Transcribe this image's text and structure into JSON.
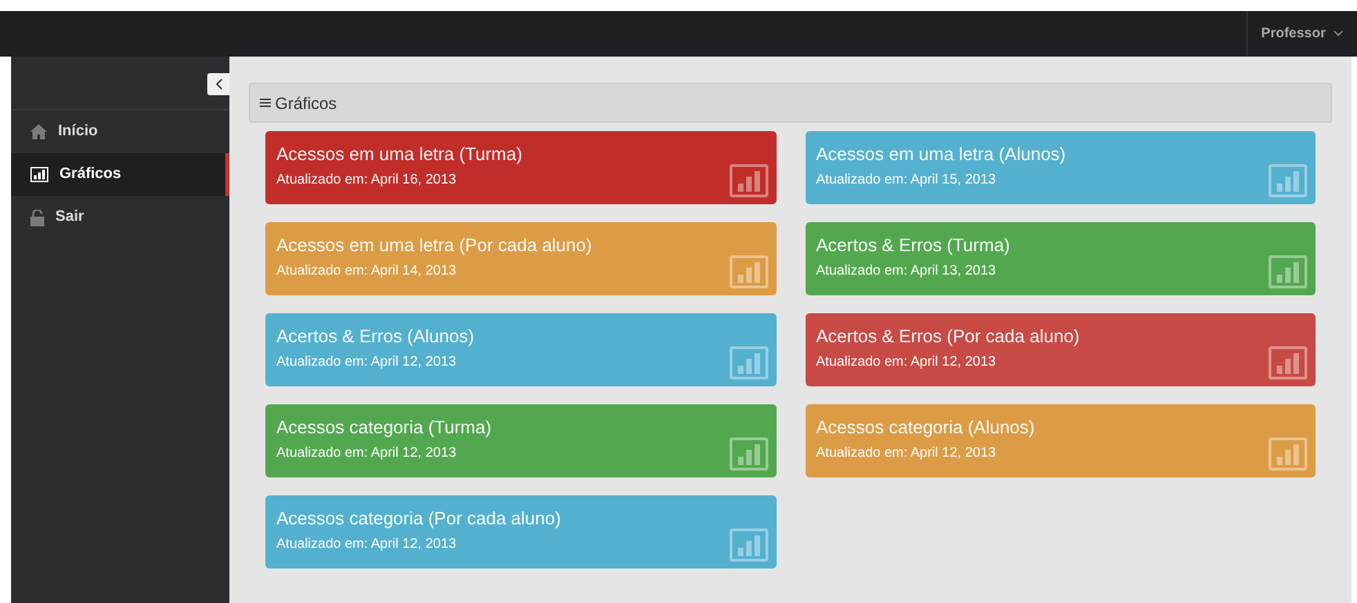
{
  "topbar": {
    "user_menu": "Professor"
  },
  "sidebar": {
    "items": [
      {
        "label": "Início",
        "selected": false
      },
      {
        "label": "Gráficos",
        "selected": true
      },
      {
        "label": "Sair",
        "selected": false
      }
    ]
  },
  "panel": {
    "title": "Gráficos"
  },
  "tiles": [
    {
      "title": "Acessos em uma letra (Turma)",
      "updated": "Atualizado em: April 16, 2013",
      "color": "#c12e2a"
    },
    {
      "title": "Acessos em uma letra (Alunos)",
      "updated": "Atualizado em: April 15, 2013",
      "color": "#54b0cf"
    },
    {
      "title": "Acessos em uma letra (Por cada aluno)",
      "updated": "Atualizado em: April 14, 2013",
      "color": "#dc9c45"
    },
    {
      "title": "Acertos & Erros (Turma)",
      "updated": "Atualizado em: April 13, 2013",
      "color": "#53a84f"
    },
    {
      "title": "Acertos & Erros (Alunos)",
      "updated": "Atualizado em: April 12, 2013",
      "color": "#54b0cf"
    },
    {
      "title": "Acertos & Erros (Por cada aluno)",
      "updated": "Atualizado em: April 12, 2013",
      "color": "#c84a45"
    },
    {
      "title": "Acessos categoria (Turma)",
      "updated": "Atualizado em: April 12, 2013",
      "color": "#53a84f"
    },
    {
      "title": "Acessos categoria (Alunos)",
      "updated": "Atualizado em: April 12, 2013",
      "color": "#dc9c45"
    },
    {
      "title": "Acessos categoria (Por cada aluno)",
      "updated": "Atualizado em: April 12, 2013",
      "color": "#54b0cf"
    }
  ]
}
